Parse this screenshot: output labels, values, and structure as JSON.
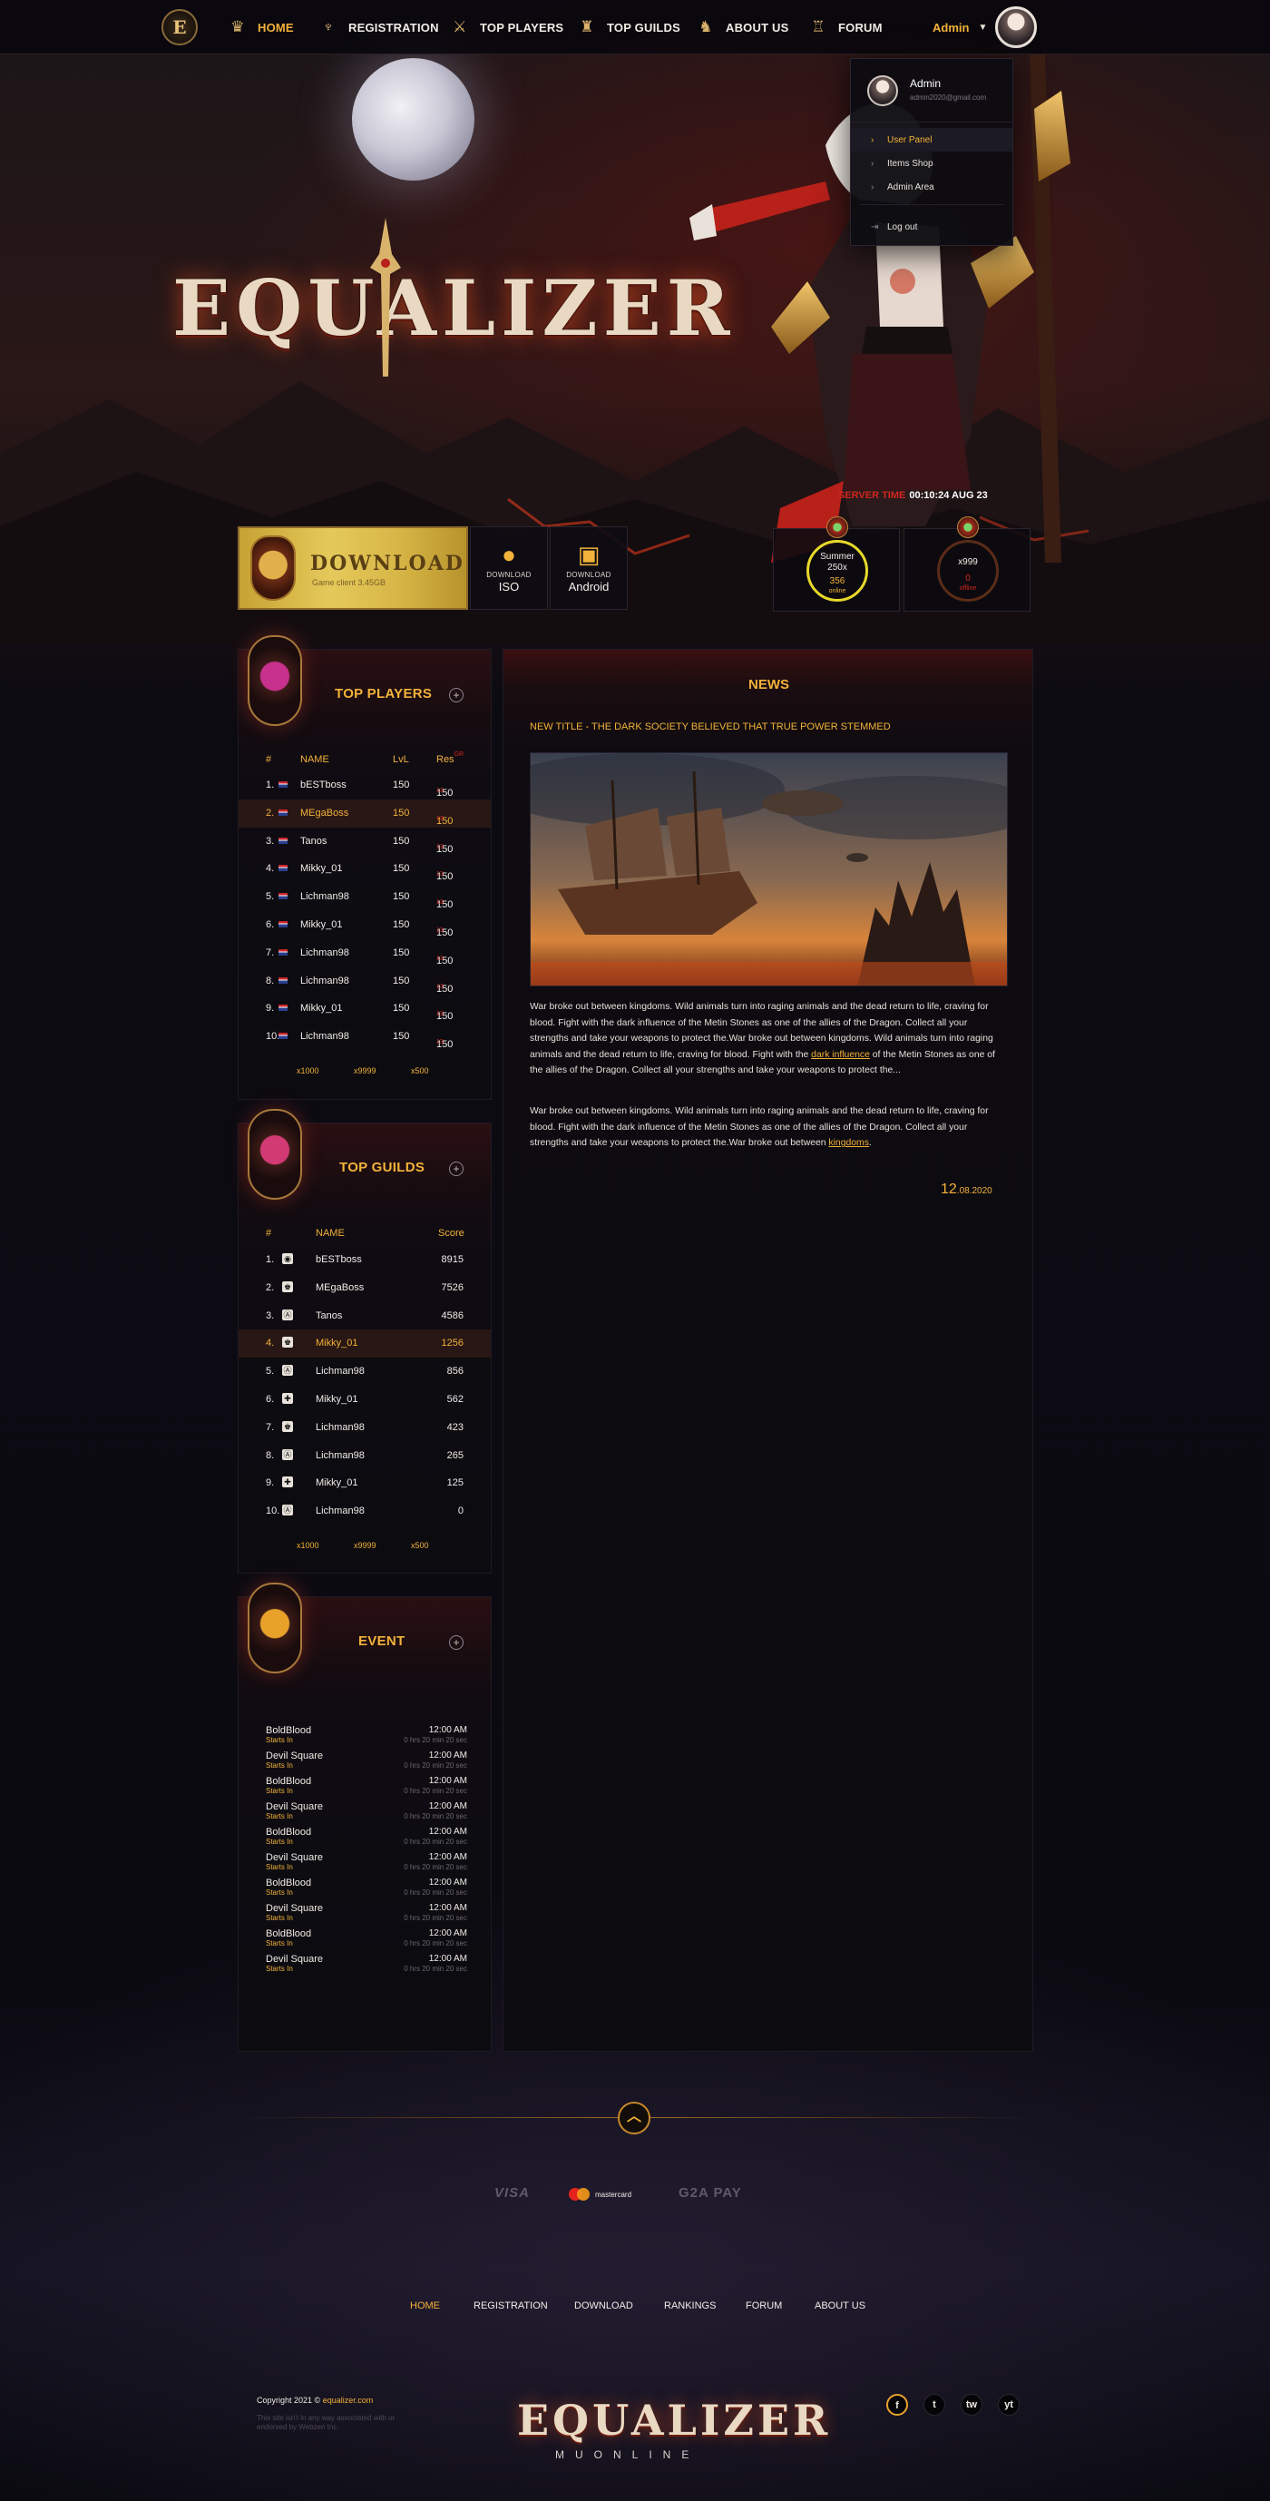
{
  "nav": {
    "brand_letter": "E",
    "items": [
      {
        "label": "HOME",
        "icon": "home-crest-icon"
      },
      {
        "label": "REGISTRATION",
        "icon": "registration-claw-icon"
      },
      {
        "label": "TOP PLAYERS",
        "icon": "crossed-swords-icon"
      },
      {
        "label": "TOP GUILDS",
        "icon": "guild-banner-icon"
      },
      {
        "label": "ABOUT US",
        "icon": "helmet-icon"
      },
      {
        "label": "FORUM",
        "icon": "castle-icon"
      }
    ],
    "user_label": "Admin"
  },
  "user_menu": {
    "name": "Admin",
    "email": "admin2020@gmail.com",
    "items": [
      "User Panel",
      "Items Shop",
      "Admin Area"
    ],
    "logout": "Log out"
  },
  "hero": {
    "logo_text": "EQUALIZER"
  },
  "download": {
    "title": "DOWNLOAD",
    "subtitle": "Game client 3.45GB",
    "ios": {
      "top": "DOWNLOAD",
      "bottom": "ISO"
    },
    "android": {
      "top": "DOWNLOAD",
      "bottom": "Android"
    }
  },
  "server": {
    "time_label": "SERVER TIME",
    "time_value": "00:10:24 AUG 23",
    "servers": [
      {
        "name": "Summer",
        "rate": "250x",
        "count": "356",
        "status": "online",
        "status_color": "#e8d92a"
      },
      {
        "name": "",
        "rate": "x999",
        "count": "0",
        "status": "offline",
        "status_color": "#d4261c"
      }
    ]
  },
  "top_players": {
    "title": "TOP PLAYERS",
    "columns": [
      "#",
      "NAME",
      "LvL",
      "Res"
    ],
    "res_superscript": "GR",
    "rows": [
      {
        "rank": "1.",
        "name": "bESTboss",
        "lvl": "150",
        "res": "150",
        "sup": "13"
      },
      {
        "rank": "2.",
        "name": "MEgaBoss",
        "lvl": "150",
        "res": "150",
        "sup": "13"
      },
      {
        "rank": "3.",
        "name": "Tanos",
        "lvl": "150",
        "res": "150",
        "sup": "13"
      },
      {
        "rank": "4.",
        "name": "Mikky_01",
        "lvl": "150",
        "res": "150",
        "sup": "13"
      },
      {
        "rank": "5.",
        "name": "Lichman98",
        "lvl": "150",
        "res": "150",
        "sup": "13"
      },
      {
        "rank": "6.",
        "name": "Mikky_01",
        "lvl": "150",
        "res": "150",
        "sup": "13"
      },
      {
        "rank": "7.",
        "name": "Lichman98",
        "lvl": "150",
        "res": "150",
        "sup": "13"
      },
      {
        "rank": "8.",
        "name": "Lichman98",
        "lvl": "150",
        "res": "150",
        "sup": "13"
      },
      {
        "rank": "9.",
        "name": "Mikky_01",
        "lvl": "150",
        "res": "150",
        "sup": "13"
      },
      {
        "rank": "10.",
        "name": "Lichman98",
        "lvl": "150",
        "res": "150",
        "sup": "13"
      }
    ],
    "pager": [
      "x1000",
      "x9999",
      "x500"
    ]
  },
  "top_guilds": {
    "title": "TOP GUILDS",
    "columns": [
      "#",
      "NAME",
      "Score"
    ],
    "rows": [
      {
        "rank": "1.",
        "name": "bESTboss",
        "score": "8915"
      },
      {
        "rank": "2.",
        "name": "MEgaBoss",
        "score": "7526"
      },
      {
        "rank": "3.",
        "name": "Tanos",
        "score": "4586"
      },
      {
        "rank": "4.",
        "name": "Mikky_01",
        "score": "1256"
      },
      {
        "rank": "5.",
        "name": "Lichman98",
        "score": "856"
      },
      {
        "rank": "6.",
        "name": "Mikky_01",
        "score": "562"
      },
      {
        "rank": "7.",
        "name": "Lichman98",
        "score": "423"
      },
      {
        "rank": "8.",
        "name": "Lichman98",
        "score": "265"
      },
      {
        "rank": "9.",
        "name": "Mikky_01",
        "score": "125"
      },
      {
        "rank": "10.",
        "name": "Lichman98",
        "score": "0"
      }
    ],
    "pager": [
      "x1000",
      "x9999",
      "x500"
    ]
  },
  "event": {
    "title": "EVENT",
    "rows": [
      {
        "name": "BoldBlood",
        "starts": "Starts In",
        "time": "12:00 AM",
        "countdown": "0 hrs 20 min 20 sec"
      },
      {
        "name": "Devil Square",
        "starts": "Starts In",
        "time": "12:00 AM",
        "countdown": "0 hrs 20 min 20 sec"
      },
      {
        "name": "BoldBlood",
        "starts": "Starts In",
        "time": "12:00 AM",
        "countdown": "0 hrs 20 min 20 sec"
      },
      {
        "name": "Devil Square",
        "starts": "Starts In",
        "time": "12:00 AM",
        "countdown": "0 hrs 20 min 20 sec"
      },
      {
        "name": "BoldBlood",
        "starts": "Starts In",
        "time": "12:00 AM",
        "countdown": "0 hrs 20 min 20 sec"
      },
      {
        "name": "Devil Square",
        "starts": "Starts In",
        "time": "12:00 AM",
        "countdown": "0 hrs 20 min 20 sec"
      },
      {
        "name": "BoldBlood",
        "starts": "Starts In",
        "time": "12:00 AM",
        "countdown": "0 hrs 20 min 20 sec"
      },
      {
        "name": "Devil Square",
        "starts": "Starts In",
        "time": "12:00 AM",
        "countdown": "0 hrs 20 min 20 sec"
      },
      {
        "name": "BoldBlood",
        "starts": "Starts In",
        "time": "12:00 AM",
        "countdown": "0 hrs 20 min 20 sec"
      },
      {
        "name": "Devil Square",
        "starts": "Starts In",
        "time": "12:00 AM",
        "countdown": "0 hrs 20 min 20 sec"
      }
    ]
  },
  "news": {
    "header": "NEWS",
    "title": "NEW TITLE - THE DARK SOCIETY BELIEVED THAT TRUE POWER STEMMED",
    "p1_a": "War broke out between kingdoms. Wild animals turn into raging animals and the dead return to life, craving for blood. Fight with the dark influence of the Metin Stones as one of the allies of the Dragon. Collect all your strengths and take your weapons to protect the.War broke out between kingdoms. Wild animals turn into raging animals and the dead return to life, craving for blood. Fight with the ",
    "p1_link": "dark influence",
    "p1_b": " of the Metin Stones as one of the allies of the Dragon. Collect all your strengths and take your weapons to protect the...",
    "p2_a": "War broke out between kingdoms. Wild animals turn into raging animals and the dead return to life, craving for blood. Fight with the dark influence of the Metin Stones as one of the allies of the Dragon. Collect all your strengths and take your weapons to protect the.War broke out between ",
    "p2_link": "kingdoms",
    "p2_b": ".",
    "date_day": "12",
    "date_rest": ".08.2020"
  },
  "payments": [
    "VISA",
    "mastercard",
    "G2A PAY"
  ],
  "footer": {
    "nav": [
      "HOME",
      "REGISTRATION",
      "DOWNLOAD",
      "RANKINGS",
      "FORUM",
      "ABOUT US"
    ],
    "copyright": "Copyright 2021 ©",
    "domain": "equalizer.com",
    "disclaimer": "This site isn't in any way associated with or endorsed by Webzen Inc.",
    "logo": "EQUALIZER",
    "logo_sub": "MUONLINE",
    "social": [
      "f",
      "t",
      "tw",
      "yt"
    ],
    "social_icons": [
      "facebook-icon",
      "twitter-icon",
      "twitch-icon",
      "youtube-icon"
    ]
  },
  "colors": {
    "accent": "#f3b23a",
    "danger": "#d4261c",
    "online": "#e8d92a",
    "bg": "#0b0a11"
  }
}
